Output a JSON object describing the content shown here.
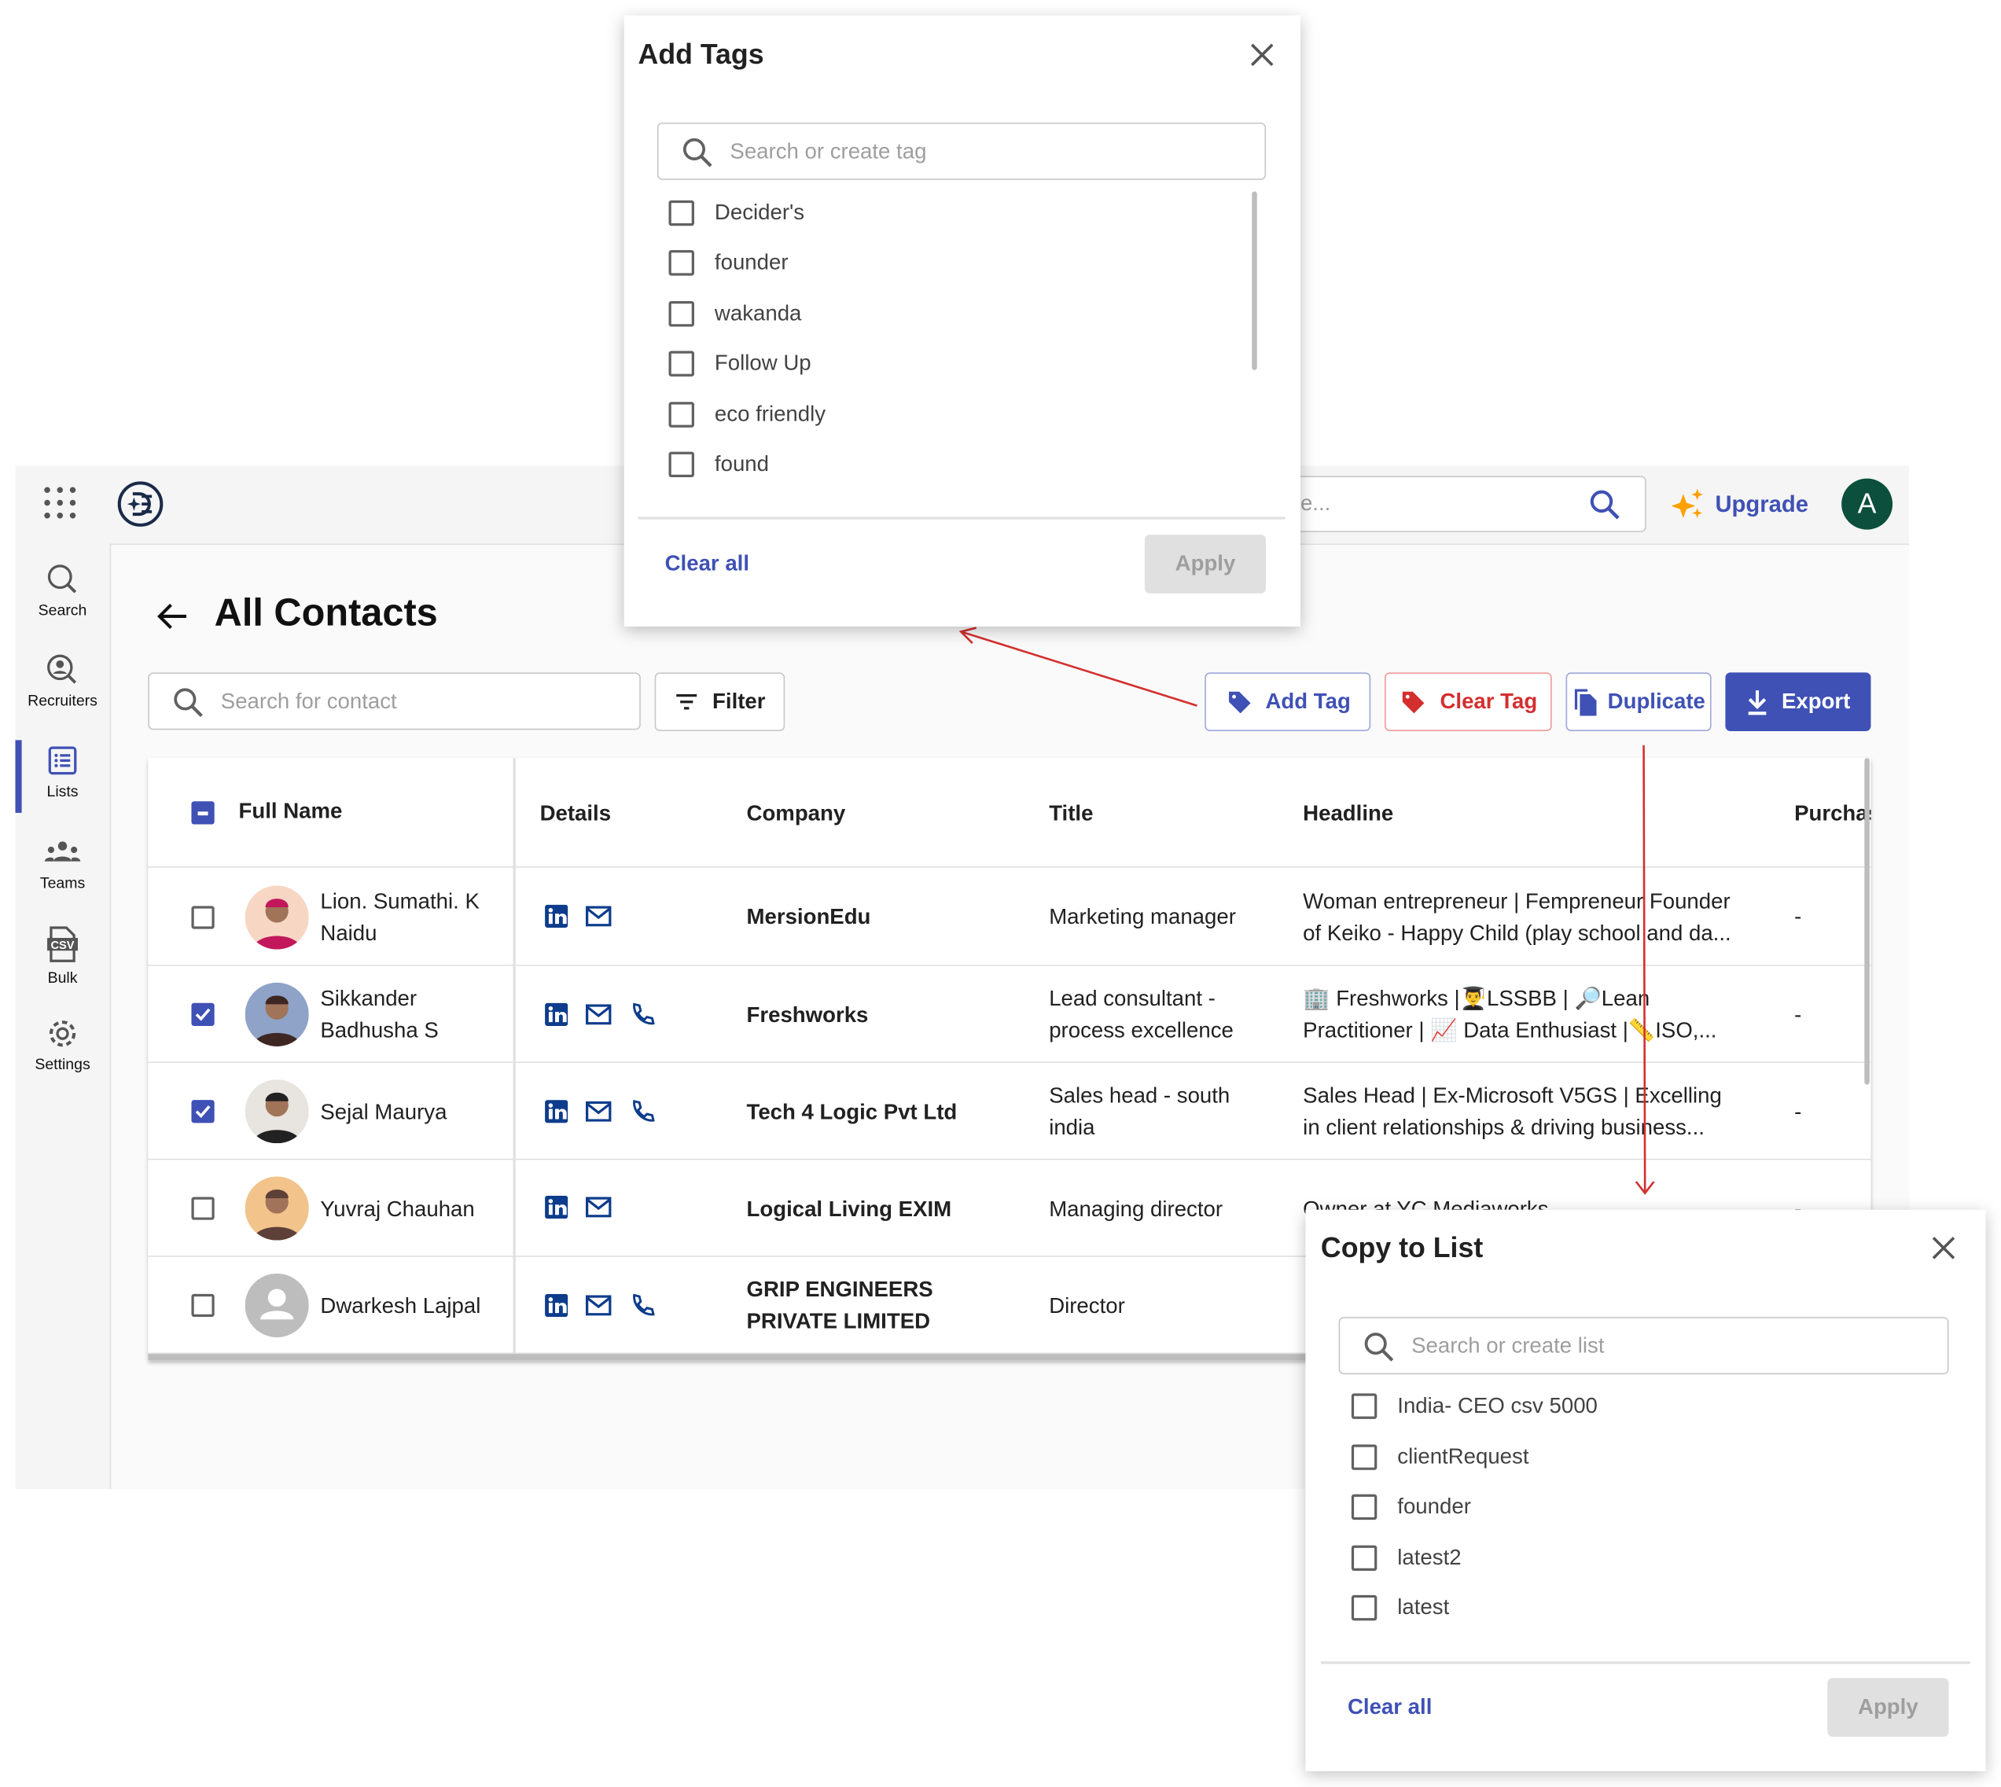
{
  "topbar": {
    "search_placeholder_visible": "e...",
    "upgrade_label": "Upgrade",
    "avatar_initial": "A"
  },
  "sidebar": {
    "items": [
      {
        "label": "Search"
      },
      {
        "label": "Recruiters"
      },
      {
        "label": "Lists",
        "active": true
      },
      {
        "label": "Teams"
      },
      {
        "label": "Bulk"
      },
      {
        "label": "Settings"
      }
    ]
  },
  "page": {
    "title": "All Contacts",
    "search_placeholder": "Search for contact",
    "filter_label": "Filter"
  },
  "actions": {
    "add_tag": "Add Tag",
    "clear_tag": "Clear Tag",
    "duplicate": "Duplicate",
    "export": "Export"
  },
  "colors": {
    "primary": "#3f51b5",
    "danger": "#d32f2f",
    "avatar_bg": "#0b4f3c",
    "annotation": "#d32f2f"
  },
  "table": {
    "columns": [
      "Full Name",
      "Details",
      "Company",
      "Title",
      "Headline",
      "Purchas"
    ],
    "rows": [
      {
        "checked": false,
        "name1": "Lion. Sumathi. K",
        "name2": "Naidu",
        "phone": false,
        "company1": "MersionEdu",
        "company2": "",
        "title1": "Marketing manager",
        "title2": "",
        "headline1": "Woman entrepreneur | Fempreneur Founder",
        "headline2": "of Keiko - Happy Child (play school and da...",
        "purchase": "-"
      },
      {
        "checked": true,
        "name1": "Sikkander",
        "name2": "Badhusha S",
        "phone": true,
        "company1": "Freshworks",
        "company2": "",
        "title1": "Lead consultant -",
        "title2": "process excellence",
        "headline1": "🏢 Freshworks |👨‍🎓LSSBB | 🔎Lean",
        "headline2": "Practitioner | 📈 Data Enthusiast |📏ISO,...",
        "purchase": "-"
      },
      {
        "checked": true,
        "name1": "Sejal Maurya",
        "name2": "",
        "phone": true,
        "company1": "Tech 4 Logic Pvt Ltd",
        "company2": "",
        "title1": "Sales head - south",
        "title2": "india",
        "headline1": "Sales Head | Ex-Microsoft V5GS | Excelling",
        "headline2": "in client relationships & driving business...",
        "purchase": "-"
      },
      {
        "checked": false,
        "name1": "Yuvraj Chauhan",
        "name2": "",
        "phone": false,
        "company1": "Logical Living EXIM",
        "company2": "",
        "title1": "Managing director",
        "title2": "",
        "headline1": "Owner at YC Mediaworks",
        "headline2": "",
        "purchase": "-"
      },
      {
        "checked": false,
        "name1": "Dwarkesh Lajpal",
        "name2": "",
        "phone": true,
        "company1": "GRIP ENGINEERS",
        "company2": "PRIVATE LIMITED",
        "title1": "Director",
        "title2": "",
        "headline1": "",
        "headline2": "",
        "purchase": ""
      }
    ]
  },
  "add_tags_modal": {
    "title": "Add Tags",
    "search_placeholder": "Search or create tag",
    "options": [
      "Decider's",
      "founder",
      "wakanda",
      "Follow Up",
      "eco friendly",
      "found"
    ],
    "clear_all": "Clear all",
    "apply": "Apply"
  },
  "copy_list_modal": {
    "title": "Copy to List",
    "search_placeholder": "Search or create list",
    "options": [
      "India- CEO csv 5000",
      "clientRequest",
      "founder",
      "latest2",
      "latest"
    ],
    "clear_all": "Clear all",
    "apply": "Apply"
  }
}
